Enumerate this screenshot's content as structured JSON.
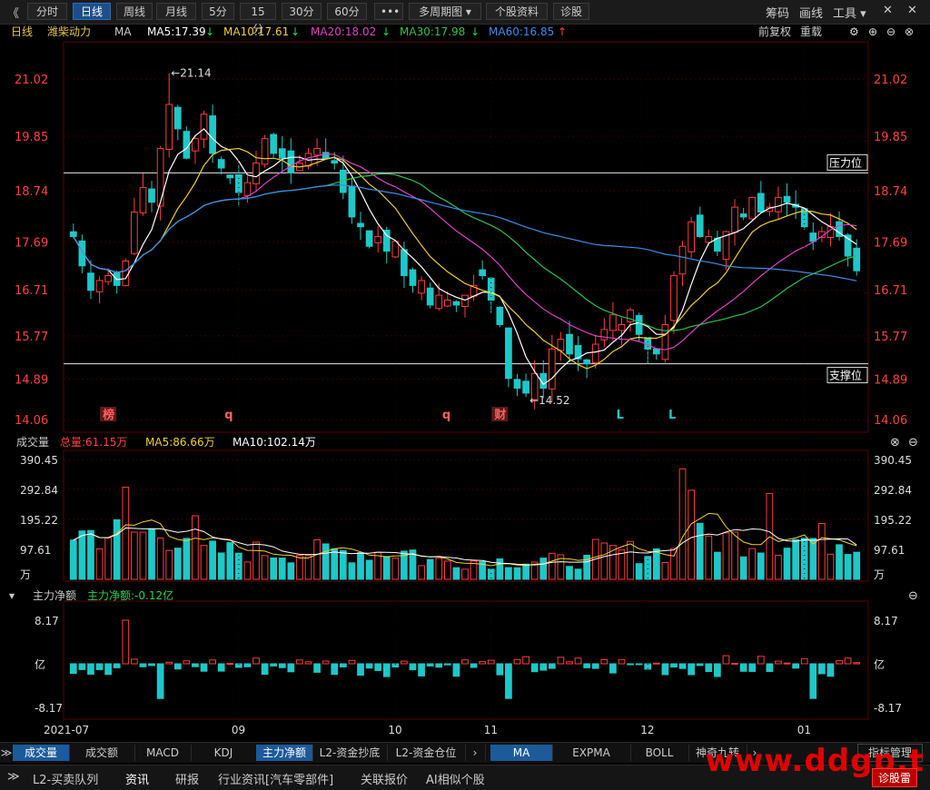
{
  "toolbar": {
    "back": "《",
    "buttons": [
      "分时",
      "日线",
      "周线",
      "月线",
      "5分",
      "15分",
      "30分",
      "60分",
      "•••",
      "多周期图 ▾",
      "个股资料",
      "诊股"
    ],
    "active_index": 1,
    "right": [
      "筹码",
      "画线",
      "工具 ▾",
      "✕",
      "✕"
    ]
  },
  "legend": {
    "period": "日线",
    "name": "潍柴动力",
    "ma_label": "MA",
    "ma5": "MA5:17.39",
    "ma10": "MA10:17.61",
    "ma20": "MA20:18.02",
    "ma30": "MA30:17.98",
    "ma60": "MA60:16.85",
    "arrow_down": "↓",
    "arrow_up": "↑",
    "fq": "前复权",
    "reload": "重载"
  },
  "colors": {
    "up": "#ff3b3b",
    "down": "#1ec8c8",
    "ma5": "#ffffff",
    "ma10": "#f1d02c",
    "ma20": "#e040c8",
    "ma30": "#30c050",
    "ma60": "#3a8ee8",
    "grid": "#3a0000"
  },
  "main_axis": {
    "ticks": [
      "21.02",
      "19.85",
      "18.74",
      "17.69",
      "16.71",
      "15.77",
      "14.89",
      "14.06"
    ],
    "high_label": "21.14",
    "low_label": "14.52",
    "resistance": "压力位",
    "support": "支撑位",
    "markers": [
      "榜",
      "q",
      "q",
      "财",
      "L",
      "L"
    ]
  },
  "volume": {
    "title": "成交量",
    "total": "总量:61.15万",
    "ma5": "MA5:86.66万",
    "ma10": "MA10:102.14万",
    "ticks": [
      "390.45",
      "292.84",
      "195.22",
      "97.61",
      "万"
    ]
  },
  "flow": {
    "title": "主力净额",
    "value": "主力净额:-0.12亿",
    "ticks": [
      "8.17",
      "亿",
      "-8.17"
    ]
  },
  "x_axis": [
    "2021-07",
    "09",
    "10",
    "11",
    "12",
    "01"
  ],
  "chart_data": {
    "type": "candlestick",
    "ylim": [
      14.06,
      21.52
    ],
    "price_ticks": [
      21.02,
      19.85,
      18.74,
      17.69,
      16.71,
      15.77,
      14.89,
      14.06
    ],
    "resistance_level": 19.1,
    "support_level": 15.2,
    "high": 21.14,
    "low": 14.52,
    "ma_latest": {
      "MA5": 17.39,
      "MA10": 17.61,
      "MA20": 18.02,
      "MA30": 17.98,
      "MA60": 16.85
    },
    "volume_ylim": [
      0,
      390.45
    ],
    "flow_ylim": [
      -8.17,
      8.17
    ],
    "close_path": [
      17.8,
      17.2,
      16.7,
      16.9,
      17.0,
      16.8,
      17.3,
      18.3,
      18.8,
      18.5,
      19.6,
      20.5,
      20.0,
      19.4,
      19.8,
      20.3,
      19.5,
      19.2,
      19.0,
      18.7,
      18.9,
      19.3,
      19.8,
      19.5,
      19.4,
      19.1,
      19.3,
      19.5,
      19.6,
      19.4,
      19.3,
      18.7,
      18.2,
      18.0,
      17.6,
      17.8,
      17.5,
      17.7,
      17.0,
      16.8,
      16.9,
      16.4,
      16.6,
      16.5,
      16.4,
      16.6,
      16.8,
      17.0,
      16.5,
      16.0,
      14.9,
      14.7,
      14.6,
      15.0,
      14.7,
      15.5,
      15.7,
      15.4,
      15.3,
      15.2,
      15.6,
      15.9,
      16.2,
      16.0,
      16.3,
      15.8,
      15.5,
      15.4,
      16.0,
      17.0,
      17.6,
      18.1,
      17.8,
      17.8,
      17.5,
      17.9,
      18.4,
      18.2,
      18.6,
      18.3,
      18.4,
      18.6,
      18.5,
      18.4,
      18.0,
      17.7,
      17.9,
      18.0,
      17.8,
      17.4,
      17.1
    ]
  }
}
